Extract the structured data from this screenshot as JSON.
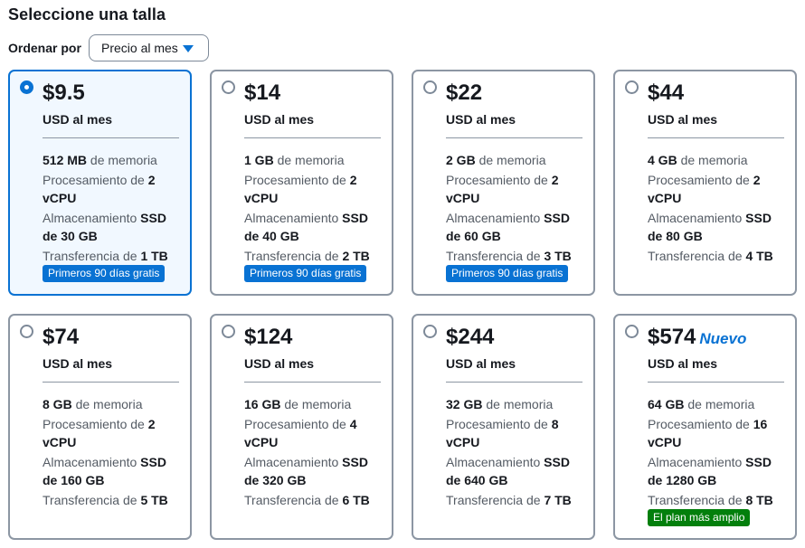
{
  "heading": "Seleccione una talla",
  "sort": {
    "label": "Ordenar por",
    "selected": "Precio al mes"
  },
  "colors": {
    "accent": "#0972d3",
    "green_badge": "#037f0c",
    "border": "#8c96a3"
  },
  "cards": [
    {
      "price": "$9.5",
      "unit": "USD al mes",
      "selected": true,
      "memory": "512 MB",
      "memory_label": "de memoria",
      "cpu_label": "Procesamiento de",
      "cpu": "2 vCPU",
      "storage_label": "Almacenamiento",
      "storage": "SSD de 30 GB",
      "transfer_label": "Transferencia de",
      "transfer": "1 TB",
      "badge": "Primeros 90 días gratis",
      "badge_color": "blue",
      "tag": ""
    },
    {
      "price": "$14",
      "unit": "USD al mes",
      "selected": false,
      "memory": "1 GB",
      "memory_label": "de memoria",
      "cpu_label": "Procesamiento de",
      "cpu": "2 vCPU",
      "storage_label": "Almacenamiento",
      "storage": "SSD de 40 GB",
      "transfer_label": "Transferencia de",
      "transfer": "2 TB",
      "badge": "Primeros 90 días gratis",
      "badge_color": "blue",
      "tag": ""
    },
    {
      "price": "$22",
      "unit": "USD al mes",
      "selected": false,
      "memory": "2 GB",
      "memory_label": "de memoria",
      "cpu_label": "Procesamiento de",
      "cpu": "2 vCPU",
      "storage_label": "Almacenamiento",
      "storage": "SSD de 60 GB",
      "transfer_label": "Transferencia de",
      "transfer": "3 TB",
      "badge": "Primeros 90 días gratis",
      "badge_color": "blue",
      "tag": ""
    },
    {
      "price": "$44",
      "unit": "USD al mes",
      "selected": false,
      "memory": "4 GB",
      "memory_label": "de memoria",
      "cpu_label": "Procesamiento de",
      "cpu": "2 vCPU",
      "storage_label": "Almacenamiento",
      "storage": "SSD de 80 GB",
      "transfer_label": "Transferencia de",
      "transfer": "4 TB",
      "badge": "",
      "badge_color": "",
      "tag": ""
    },
    {
      "price": "$74",
      "unit": "USD al mes",
      "selected": false,
      "memory": "8 GB",
      "memory_label": "de memoria",
      "cpu_label": "Procesamiento de",
      "cpu": "2 vCPU",
      "storage_label": "Almacenamiento",
      "storage": "SSD de 160 GB",
      "transfer_label": "Transferencia de",
      "transfer": "5 TB",
      "badge": "",
      "badge_color": "",
      "tag": ""
    },
    {
      "price": "$124",
      "unit": "USD al mes",
      "selected": false,
      "memory": "16 GB",
      "memory_label": "de memoria",
      "cpu_label": "Procesamiento de",
      "cpu": "4 vCPU",
      "storage_label": "Almacenamiento",
      "storage": "SSD de 320 GB",
      "transfer_label": "Transferencia de",
      "transfer": "6 TB",
      "badge": "",
      "badge_color": "",
      "tag": ""
    },
    {
      "price": "$244",
      "unit": "USD al mes",
      "selected": false,
      "memory": "32 GB",
      "memory_label": "de memoria",
      "cpu_label": "Procesamiento de",
      "cpu": "8 vCPU",
      "storage_label": "Almacenamiento",
      "storage": "SSD de 640 GB",
      "transfer_label": "Transferencia de",
      "transfer": "7 TB",
      "badge": "",
      "badge_color": "",
      "tag": ""
    },
    {
      "price": "$574",
      "unit": "USD al mes",
      "selected": false,
      "memory": "64 GB",
      "memory_label": "de memoria",
      "cpu_label": "Procesamiento de",
      "cpu": "16 vCPU",
      "storage_label": "Almacenamiento",
      "storage": "SSD de 1280 GB",
      "transfer_label": "Transferencia de",
      "transfer": "8 TB",
      "badge": "El plan más amplio",
      "badge_color": "green",
      "tag": "Nuevo"
    }
  ]
}
